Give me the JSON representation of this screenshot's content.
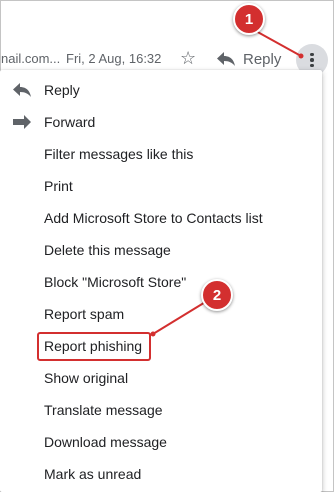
{
  "header": {
    "sender_email": "nail.com...",
    "timestamp": "Fri, 2 Aug, 16:32",
    "star_icon": "star-icon",
    "reply_label": "Reply",
    "more_icon": "more-vert-icon"
  },
  "menu": {
    "items": [
      {
        "label": "Reply",
        "icon": "reply-icon"
      },
      {
        "label": "Forward",
        "icon": "forward-icon"
      },
      {
        "label": "Filter messages like this"
      },
      {
        "label": "Print"
      },
      {
        "label": "Add Microsoft Store to Contacts list"
      },
      {
        "label": "Delete this message"
      },
      {
        "label": "Block \"Microsoft Store\""
      },
      {
        "label": "Report spam"
      },
      {
        "label": "Report phishing"
      },
      {
        "label": "Show original"
      },
      {
        "label": "Translate message"
      },
      {
        "label": "Download message"
      },
      {
        "label": "Mark as unread"
      }
    ]
  },
  "annotations": {
    "callout_1": "1",
    "callout_2": "2",
    "color": "#d32f2f"
  }
}
